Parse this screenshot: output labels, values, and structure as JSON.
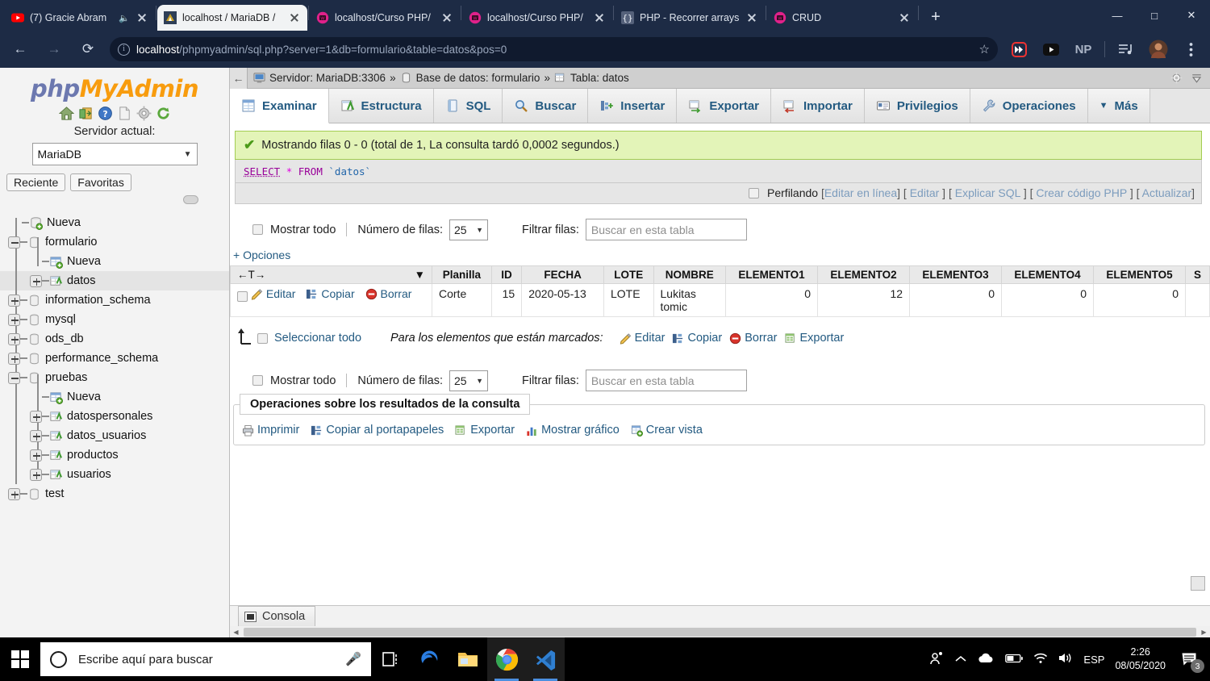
{
  "browser": {
    "tabs": [
      {
        "title": "(7) Gracie Abram",
        "favicon": "youtube-icon",
        "muted": true,
        "active": false
      },
      {
        "title": "localhost / MariaDB /",
        "favicon": "mariadb-icon",
        "muted": false,
        "active": true
      },
      {
        "title": "localhost/Curso PHP/",
        "favicon": "php-icon",
        "muted": false,
        "active": false
      },
      {
        "title": "localhost/Curso PHP/",
        "favicon": "php-icon",
        "muted": false,
        "active": false
      },
      {
        "title": "PHP - Recorrer arrays",
        "favicon": "code-braces-icon",
        "muted": false,
        "active": false
      },
      {
        "title": "CRUD",
        "favicon": "php-icon",
        "muted": false,
        "active": false
      }
    ],
    "new_tab_label": "+",
    "window_controls": [
      "minimize",
      "maximize",
      "close"
    ],
    "url": {
      "host": "localhost",
      "path": "/phpmyadmin/sql.php?server=1&db=formulario&table=datos&pos=0"
    },
    "nav": {
      "back": "back-icon",
      "forward": "forward-icon",
      "reload": "reload-icon"
    },
    "extensions": [
      "bookmark-star-icon",
      "fast-forward-icon",
      "youtube-icon",
      "np-icon",
      "playlist-icon",
      "avatar-icon",
      "chrome-menu-icon"
    ],
    "profile_initials": "NP"
  },
  "sidebar": {
    "logo": {
      "php": "php",
      "my": "My",
      "admin": "Admin"
    },
    "icons": [
      "home-icon",
      "logout-icon",
      "help-icon",
      "docs-icon",
      "settings-icon",
      "reload-icon"
    ],
    "server_label": "Servidor actual:",
    "server_value": "MariaDB",
    "pills": [
      "Reciente",
      "Favoritas"
    ],
    "tree": [
      {
        "label": "Nueva",
        "depth": 1,
        "icon": "new-db-icon",
        "toggle": "none",
        "selected": false
      },
      {
        "label": "formulario",
        "depth": 1,
        "icon": "db-icon",
        "toggle": "minus",
        "selected": false
      },
      {
        "label": "Nueva",
        "depth": 2,
        "icon": "new-table-icon",
        "toggle": "none",
        "selected": false
      },
      {
        "label": "datos",
        "depth": 2,
        "icon": "table-icon",
        "toggle": "plus",
        "selected": true
      },
      {
        "label": "information_schema",
        "depth": 1,
        "icon": "db-icon",
        "toggle": "plus",
        "selected": false
      },
      {
        "label": "mysql",
        "depth": 1,
        "icon": "db-icon",
        "toggle": "plus",
        "selected": false
      },
      {
        "label": "ods_db",
        "depth": 1,
        "icon": "db-icon",
        "toggle": "plus",
        "selected": false
      },
      {
        "label": "performance_schema",
        "depth": 1,
        "icon": "db-icon",
        "toggle": "plus",
        "selected": false
      },
      {
        "label": "pruebas",
        "depth": 1,
        "icon": "db-icon",
        "toggle": "minus",
        "selected": false
      },
      {
        "label": "Nueva",
        "depth": 2,
        "icon": "new-table-icon",
        "toggle": "none",
        "selected": false
      },
      {
        "label": "datospersonales",
        "depth": 2,
        "icon": "table-icon",
        "toggle": "plus",
        "selected": false
      },
      {
        "label": "datos_usuarios",
        "depth": 2,
        "icon": "table-icon",
        "toggle": "plus",
        "selected": false
      },
      {
        "label": "productos",
        "depth": 2,
        "icon": "table-icon",
        "toggle": "plus",
        "selected": false
      },
      {
        "label": "usuarios",
        "depth": 2,
        "icon": "table-icon",
        "toggle": "plus",
        "selected": false
      },
      {
        "label": "test",
        "depth": 1,
        "icon": "db-icon",
        "toggle": "plus",
        "selected": false
      }
    ]
  },
  "breadcrumb": {
    "back": "←",
    "server": "Servidor: MariaDB:3306",
    "sep1": "»",
    "database": "Base de datos: formulario",
    "sep2": "»",
    "table": "Tabla: datos",
    "right_icons": [
      "gear-icon",
      "collapse-icon"
    ]
  },
  "tabs": [
    {
      "label": "Examinar",
      "icon": "browse-icon",
      "active": true
    },
    {
      "label": "Estructura",
      "icon": "structure-icon",
      "active": false
    },
    {
      "label": "SQL",
      "icon": "sql-icon",
      "active": false
    },
    {
      "label": "Buscar",
      "icon": "search-icon",
      "active": false
    },
    {
      "label": "Insertar",
      "icon": "insert-icon",
      "active": false
    },
    {
      "label": "Exportar",
      "icon": "export-icon",
      "active": false
    },
    {
      "label": "Importar",
      "icon": "import-icon",
      "active": false
    },
    {
      "label": "Privilegios",
      "icon": "privileges-icon",
      "active": false
    },
    {
      "label": "Operaciones",
      "icon": "operations-icon",
      "active": false
    },
    {
      "label": "Más",
      "icon": "chevron-down-icon",
      "active": false
    }
  ],
  "result": {
    "message": "Mostrando filas 0 - 0 (total de 1, La consulta tardó 0,0002 segundos.)",
    "sql": {
      "select": "SELECT",
      "star": "*",
      "from": "FROM",
      "table": "`datos`"
    },
    "tools": {
      "profiling": "Perfilando",
      "links": [
        "Editar en línea",
        "Editar",
        "Explicar SQL",
        "Crear código PHP",
        "Actualizar"
      ]
    }
  },
  "controls": {
    "show_all": "Mostrar todo",
    "rows_label": "Número de filas:",
    "rows_value": "25",
    "filter_label": "Filtrar filas:",
    "filter_placeholder": "Buscar en esta tabla",
    "options": "+ Opciones",
    "sort_marker": "←T→"
  },
  "table": {
    "headers": [
      "Planilla",
      "ID",
      "FECHA",
      "LOTE",
      "NOMBRE",
      "ELEMENTO1",
      "ELEMENTO2",
      "ELEMENTO3",
      "ELEMENTO4",
      "ELEMENTO5",
      "S"
    ],
    "row_actions": [
      {
        "label": "Editar",
        "icon": "pencil-icon"
      },
      {
        "label": "Copiar",
        "icon": "copy-icon"
      },
      {
        "label": "Borrar",
        "icon": "delete-icon"
      }
    ],
    "rows": [
      {
        "Planilla": "Corte",
        "ID": "15",
        "FECHA": "2020-05-13",
        "LOTE": "LOTE",
        "NOMBRE": "Lukitas tomic",
        "ELEMENTO1": "0",
        "ELEMENTO2": "12",
        "ELEMENTO3": "0",
        "ELEMENTO4": "0",
        "ELEMENTO5": "0",
        "S": ""
      }
    ]
  },
  "bulk": {
    "select_all": "Seleccionar todo",
    "hint": "Para los elementos que están marcados:",
    "actions": [
      {
        "label": "Editar",
        "icon": "pencil-icon"
      },
      {
        "label": "Copiar",
        "icon": "copy-icon"
      },
      {
        "label": "Borrar",
        "icon": "delete-icon"
      },
      {
        "label": "Exportar",
        "icon": "export-icon"
      }
    ]
  },
  "query_ops": {
    "title": "Operaciones sobre los resultados de la consulta",
    "links": [
      {
        "label": "Imprimir",
        "icon": "print-icon"
      },
      {
        "label": "Copiar al portapapeles",
        "icon": "copy-icon"
      },
      {
        "label": "Exportar",
        "icon": "export-icon"
      },
      {
        "label": "Mostrar gráfico",
        "icon": "chart-icon"
      },
      {
        "label": "Crear vista",
        "icon": "view-icon"
      }
    ]
  },
  "console": {
    "label": "Consola",
    "icon": "console-icon"
  },
  "taskbar": {
    "start": "windows-start-icon",
    "search_placeholder": "Escribe aquí para buscar",
    "mic": "microphone-icon",
    "apps": [
      {
        "name": "task-view-icon",
        "active": false
      },
      {
        "name": "edge-icon",
        "active": false
      },
      {
        "name": "file-explorer-icon",
        "active": false
      },
      {
        "name": "chrome-icon",
        "active": true
      },
      {
        "name": "vscode-icon",
        "active": true
      }
    ],
    "tray": [
      "people-icon",
      "show-hidden-icons-icon",
      "onedrive-icon",
      "battery-icon",
      "wifi-icon",
      "volume-icon"
    ],
    "language": "ESP",
    "time": "2:26",
    "date": "08/05/2020",
    "notifications_count": "3"
  }
}
